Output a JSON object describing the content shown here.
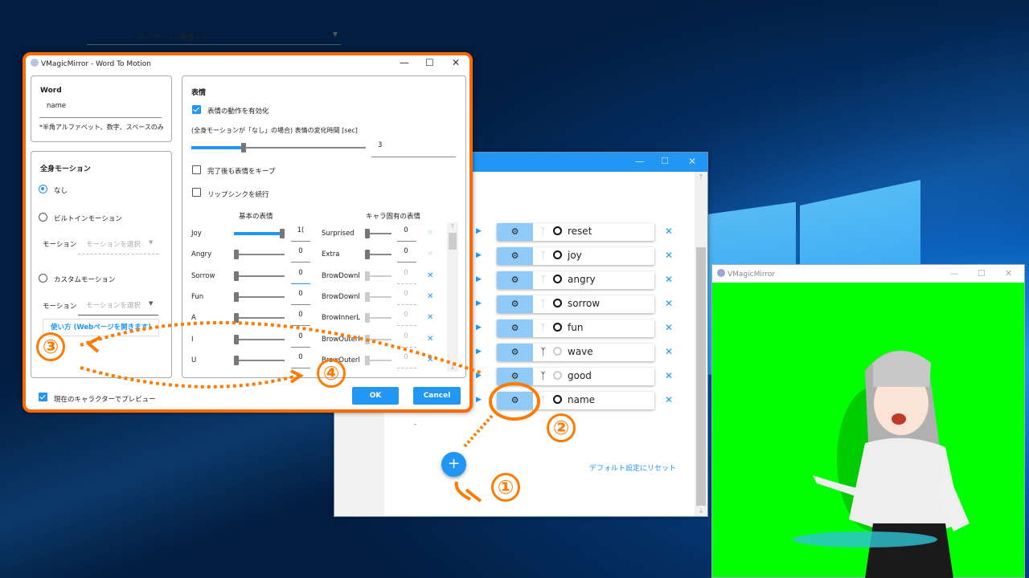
{
  "desktop": {
    "background": "windows-10-hero"
  },
  "word_to_motion": {
    "title": "VMagicMirror - Word To Motion",
    "word": {
      "heading": "Word",
      "value": "name",
      "hint": "*半角アルファベット、数字、スペースのみ"
    },
    "body_motion": {
      "heading": "全身モーション",
      "options": [
        {
          "label": "なし",
          "selected": true
        },
        {
          "label": "ビルトインモーション",
          "selected": false
        },
        {
          "label": "カスタムモーション",
          "selected": false
        }
      ],
      "builtin_motion_label": "モーション",
      "builtin_motion_placeholder": "モーションを選択",
      "custom_motion_label": "モーション",
      "custom_motion_placeholder": "モーションを選択",
      "help_link": "使い方 (Webページを開きます)"
    },
    "expression": {
      "heading": "表情",
      "enable_label": "表情の動作を有効化",
      "enable_checked": true,
      "duration_label": "(全身モーションが「なし」の場合) 表情の変化時間 [sec]",
      "duration_value": "3",
      "duration_fraction": 0.3,
      "keep_label": "完了後も表情をキープ",
      "keep_checked": false,
      "lipsync_label": "リップシンクを続行",
      "lipsync_checked": false,
      "basic_heading": "基本の表情",
      "custom_heading": "キャラ固有の表情",
      "basic": [
        {
          "name": "Joy",
          "value": "1(",
          "fraction": 1.0
        },
        {
          "name": "Angry",
          "value": "0",
          "fraction": 0
        },
        {
          "name": "Sorrow",
          "value": "0",
          "fraction": 0
        },
        {
          "name": "Fun",
          "value": "0",
          "fraction": 0
        },
        {
          "name": "A",
          "value": "0",
          "fraction": 0
        },
        {
          "name": "I",
          "value": "0",
          "fraction": 0
        },
        {
          "name": "U",
          "value": "0",
          "fraction": 0
        }
      ],
      "custom": [
        {
          "name": "Surprised",
          "value": "0",
          "enabled": true,
          "delete_enabled": false
        },
        {
          "name": "Extra",
          "value": "0",
          "enabled": true,
          "delete_enabled": false
        },
        {
          "name": "BrowDownl",
          "value": "0",
          "enabled": false,
          "delete_enabled": true
        },
        {
          "name": "BrowDownl",
          "value": "0",
          "enabled": false,
          "delete_enabled": true
        },
        {
          "name": "BrowInnerL",
          "value": "0",
          "enabled": false,
          "delete_enabled": true
        },
        {
          "name": "BrowOuterl",
          "value": "0",
          "enabled": false,
          "delete_enabled": true
        },
        {
          "name": "BrowOuterl",
          "value": "0",
          "enabled": false,
          "delete_enabled": true
        }
      ]
    },
    "preview_label": "現在のキャラクターでプレビュー",
    "preview_checked": true,
    "ok_label": "OK",
    "cancel_label": "Cancel"
  },
  "settings_window": {
    "device_select_value": "キーボード (単語入力)",
    "items": [
      {
        "word": "reset",
        "body_active": false,
        "face_active": true
      },
      {
        "word": "joy",
        "body_active": false,
        "face_active": true
      },
      {
        "word": "angry",
        "body_active": false,
        "face_active": true
      },
      {
        "word": "sorrow",
        "body_active": false,
        "face_active": true
      },
      {
        "word": "fun",
        "body_active": false,
        "face_active": true
      },
      {
        "word": "wave",
        "body_active": true,
        "face_active": false
      },
      {
        "word": "good",
        "body_active": true,
        "face_active": false
      },
      {
        "word": "name",
        "body_active": false,
        "face_active": true
      }
    ],
    "dot_text": "-",
    "reset_link": "デフォルト設定にリセット",
    "add_button_label": "+"
  },
  "preview_window": {
    "title": "VMagicMirror",
    "background_color": "#00ff00"
  },
  "annotations": {
    "color": "#ff7a00",
    "steps": [
      "①",
      "②",
      "③",
      "④"
    ]
  }
}
